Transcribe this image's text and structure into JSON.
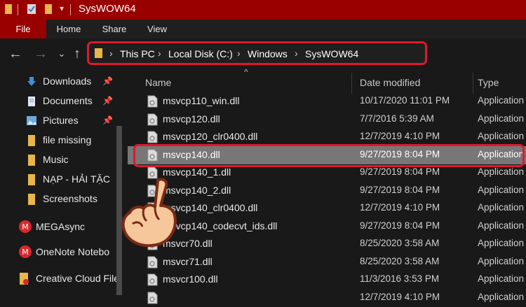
{
  "window": {
    "title": "SysWOW64"
  },
  "ribbon": {
    "tabs": [
      "File",
      "Home",
      "Share",
      "View"
    ]
  },
  "address": {
    "crumbs": [
      "This PC",
      "Local Disk (C:)",
      "Windows",
      "SysWOW64"
    ]
  },
  "sidebar": {
    "items": [
      {
        "label": "Downloads",
        "icon": "download-arrow-icon",
        "pinned": true
      },
      {
        "label": "Documents",
        "icon": "documents-icon",
        "pinned": true
      },
      {
        "label": "Pictures",
        "icon": "pictures-icon",
        "pinned": true
      },
      {
        "label": "file missing",
        "icon": "folder-icon",
        "pinned": false
      },
      {
        "label": "Music",
        "icon": "folder-icon",
        "pinned": false
      },
      {
        "label": "NẠP - HẢI TẶC",
        "icon": "folder-icon",
        "pinned": false
      },
      {
        "label": "Screenshots",
        "icon": "folder-icon",
        "pinned": false
      },
      {
        "label": "MEGAsync",
        "icon": "mega-icon",
        "pinned": false
      },
      {
        "label": "OneNote Notebo",
        "icon": "onenote-icon",
        "pinned": false
      },
      {
        "label": "Creative Cloud File",
        "icon": "creative-cloud-icon",
        "pinned": false
      }
    ]
  },
  "files": {
    "columns": [
      "Name",
      "Date modified",
      "Type"
    ],
    "rows": [
      {
        "name": "msvcp110_win.dll",
        "date": "10/17/2020 11:01 PM",
        "type": "Application"
      },
      {
        "name": "msvcp120.dll",
        "date": "7/7/2016 5:39 AM",
        "type": "Application"
      },
      {
        "name": "msvcp120_clr0400.dll",
        "date": "12/7/2019 4:10 PM",
        "type": "Application"
      },
      {
        "name": "msvcp140.dll",
        "date": "9/27/2019 8:04 PM",
        "type": "Application",
        "selected": true
      },
      {
        "name": "msvcp140_1.dll",
        "date": "9/27/2019 8:04 PM",
        "type": "Application"
      },
      {
        "name": "msvcp140_2.dll",
        "date": "9/27/2019 8:04 PM",
        "type": "Application"
      },
      {
        "name": "msvcp140_clr0400.dll",
        "date": "12/7/2019 4:10 PM",
        "type": "Application"
      },
      {
        "name": "msvcp140_codecvt_ids.dll",
        "date": "9/27/2019 8:04 PM",
        "type": "Application"
      },
      {
        "name": "msvcr70.dll",
        "date": "8/25/2020 3:58 AM",
        "type": "Application"
      },
      {
        "name": "msvcr71.dll",
        "date": "8/25/2020 3:58 AM",
        "type": "Application"
      },
      {
        "name": "msvcr100.dll",
        "date": "11/3/2016 3:53 PM",
        "type": "Application"
      },
      {
        "name": "",
        "date": "12/7/2019 4:10 PM",
        "type": "Application"
      }
    ]
  },
  "colors": {
    "titlebar": "#990000",
    "highlight": "#e0182d",
    "selected_row": "#777777"
  }
}
